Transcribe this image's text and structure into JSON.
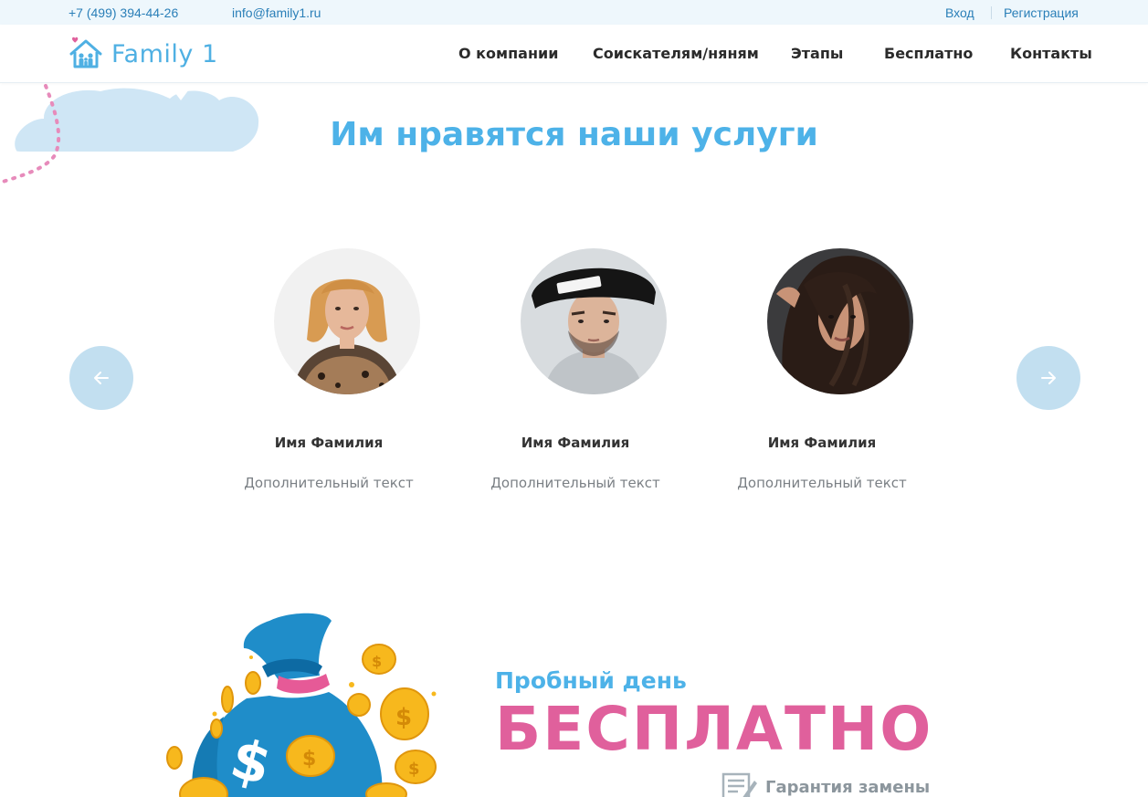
{
  "topbar": {
    "phone": "+7 (499) 394-44-26",
    "email": "info@family1.ru",
    "login": "Вход",
    "register": "Регистрация"
  },
  "header": {
    "logo_text": "Family 1",
    "nav": [
      "О компании",
      "Соискателям/няням",
      "Этапы",
      "Бесплатно",
      "Контакты"
    ]
  },
  "testimonials": {
    "title": "Им нравятся наши услуги",
    "prev_icon": "arrow-left-icon",
    "next_icon": "arrow-right-icon",
    "items": [
      {
        "name": "Имя Фамилия",
        "text": "Дополнительный текст"
      },
      {
        "name": "Имя Фамилия",
        "text": "Дополнительный текст"
      },
      {
        "name": "Имя Фамилия",
        "text": "Дополнительный текст"
      }
    ]
  },
  "promo": {
    "subtitle": "Пробный день",
    "headline": "БЕСПЛАТНО",
    "guarantee": "Гарантия замены"
  },
  "colors": {
    "accent_blue": "#4db2e8",
    "accent_pink": "#e0609c",
    "link_blue": "#2a7fb8",
    "topbar_bg": "#eef7fc",
    "arrow_bg": "#c2dff0"
  }
}
